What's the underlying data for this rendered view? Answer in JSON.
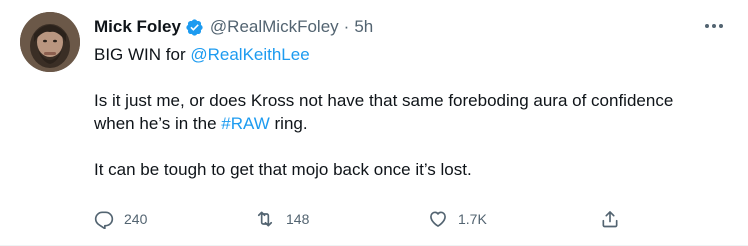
{
  "tweet": {
    "author": {
      "name": "Mick Foley",
      "handle": "@RealMickFoley",
      "verified": true
    },
    "separator": "·",
    "time": "5h",
    "body": {
      "line1_prefix": "BIG WIN for ",
      "line1_mention": "@RealKeithLee",
      "para2_before": "Is it just me, or does Kross not have that same foreboding aura of confidence when he’s in the ",
      "para2_hashtag": "#RAW",
      "para2_after": " ring.",
      "para3": "It can be tough to get that mojo back once it’s lost."
    },
    "actions": {
      "reply_count": "240",
      "retweet_count": "148",
      "like_count": "1.7K"
    },
    "icons": {
      "more": "more-icon",
      "reply": "reply-icon",
      "retweet": "retweet-icon",
      "like": "like-icon",
      "share": "share-icon",
      "verified": "verified-badge-icon"
    },
    "colors": {
      "link": "#1d9bf0",
      "muted": "#536471",
      "text": "#0f1419",
      "verified": "#1d9bf0"
    }
  }
}
